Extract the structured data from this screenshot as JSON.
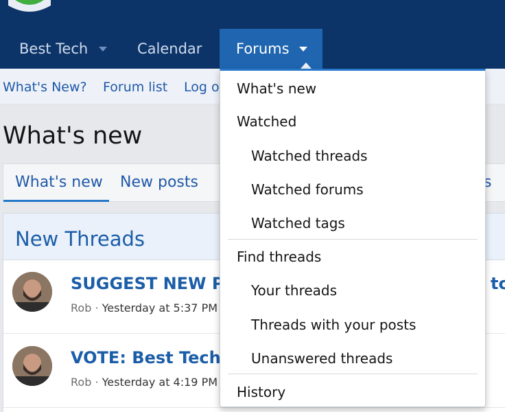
{
  "nav": {
    "items": [
      {
        "label": "Best Tech"
      },
      {
        "label": "Calendar"
      },
      {
        "label": "Forums"
      }
    ]
  },
  "subnav": {
    "links": [
      "What's New?",
      "Forum list",
      "Log o"
    ]
  },
  "page": {
    "title": "What's new",
    "tabs": [
      "What's new",
      "New posts",
      "s"
    ],
    "block_title": "New Threads",
    "threads": [
      {
        "title": "SUGGEST NEW P",
        "title_tail": "tch",
        "author": "Rob",
        "separator": "·",
        "time": "Yesterday at 5:37 PM"
      },
      {
        "title": "VOTE: Best Tech I",
        "title_tail": "",
        "author": "Rob",
        "separator": "·",
        "time": "Yesterday at 4:19 PM"
      }
    ]
  },
  "menu": {
    "items": [
      {
        "label": "What's new"
      },
      {
        "label": "Watched"
      },
      {
        "label": "Watched threads"
      },
      {
        "label": "Watched forums"
      },
      {
        "label": "Watched tags"
      },
      {
        "label": "Find threads"
      },
      {
        "label": "Your threads"
      },
      {
        "label": "Threads with your posts"
      },
      {
        "label": "Unanswered threads"
      },
      {
        "label": "History"
      }
    ]
  },
  "colors": {
    "header": "#0d3468",
    "active_nav": "#1f65b0",
    "link": "#1b5da8"
  }
}
